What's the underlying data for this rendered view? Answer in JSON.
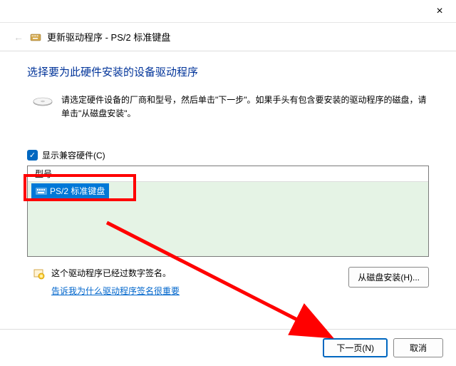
{
  "titlebar": {
    "close": "×"
  },
  "header": {
    "title": "更新驱动程序 - PS/2 标准键盘"
  },
  "content": {
    "instruction_title": "选择要为此硬件安装的设备驱动程序",
    "instruction_text": "请选定硬件设备的厂商和型号，然后单击\"下一步\"。如果手头有包含要安装的驱动程序的磁盘，请单击\"从磁盘安装\"。",
    "checkbox_label": "显示兼容硬件(C)",
    "list_header": "型号",
    "list_item": "PS/2 标准键盘",
    "signature_line1": "这个驱动程序已经过数字签名。",
    "signature_link": "告诉我为什么驱动程序签名很重要",
    "disk_install_btn": "从磁盘安装(H)..."
  },
  "buttons": {
    "next": "下一页(N)",
    "cancel": "取消"
  }
}
